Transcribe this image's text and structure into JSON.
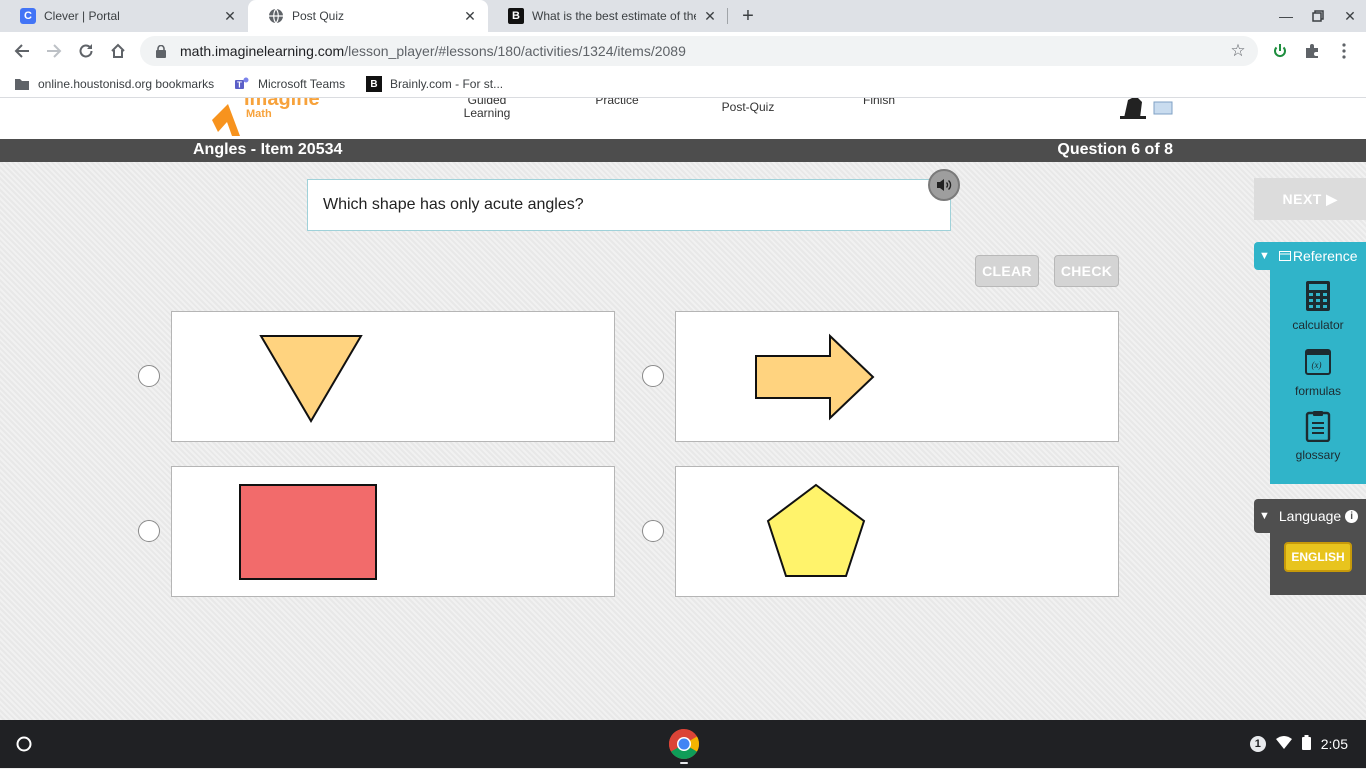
{
  "browser": {
    "tabs": [
      {
        "title": "Clever | Portal",
        "active": false,
        "icon": "clever-icon"
      },
      {
        "title": "Post Quiz",
        "active": true,
        "icon": "globe-icon"
      },
      {
        "title": "What is the best estimate of the",
        "active": false,
        "icon": "brainly-icon"
      }
    ],
    "url_host": "math.imaginelearning.com",
    "url_path": "/lesson_player/#lessons/180/activities/1324/items/2089",
    "bookmarks": [
      {
        "label": "online.houstonisd.org bookmarks",
        "icon": "folder-icon"
      },
      {
        "label": "Microsoft Teams",
        "icon": "teams-icon"
      },
      {
        "label": "Brainly.com - For st...",
        "icon": "brainly-icon"
      }
    ]
  },
  "app": {
    "logo_word": "Imagine",
    "logo_sub": "Math",
    "steps": [
      "Guided Learning",
      "Practice",
      "Post-Quiz",
      "Finish"
    ],
    "title": "Angles - Item 20534",
    "progress": "Question 6 of 8"
  },
  "question": {
    "prompt": "Which shape has only acute angles?",
    "clear_label": "CLEAR",
    "check_label": "CHECK",
    "choices": [
      {
        "shape": "triangle",
        "fill": "#ffd37f"
      },
      {
        "shape": "arrow",
        "fill": "#ffd37f"
      },
      {
        "shape": "rectangle",
        "fill": "#f26b6b"
      },
      {
        "shape": "pentagon",
        "fill": "#fff36b"
      }
    ]
  },
  "sidebar": {
    "next_label": "NEXT ▶",
    "reference_label": "Reference",
    "tools": [
      {
        "label": "calculator",
        "icon": "calculator-icon"
      },
      {
        "label": "formulas",
        "icon": "formulas-icon"
      },
      {
        "label": "glossary",
        "icon": "glossary-icon"
      }
    ],
    "language_label": "Language",
    "english_label": "ENGLISH"
  },
  "colors": {
    "accent_teal": "#30b4c9",
    "titlebar": "#4d4d4d",
    "english_yellow": "#e8c41e"
  },
  "shelf": {
    "notification_count": "1",
    "time": "2:05"
  }
}
